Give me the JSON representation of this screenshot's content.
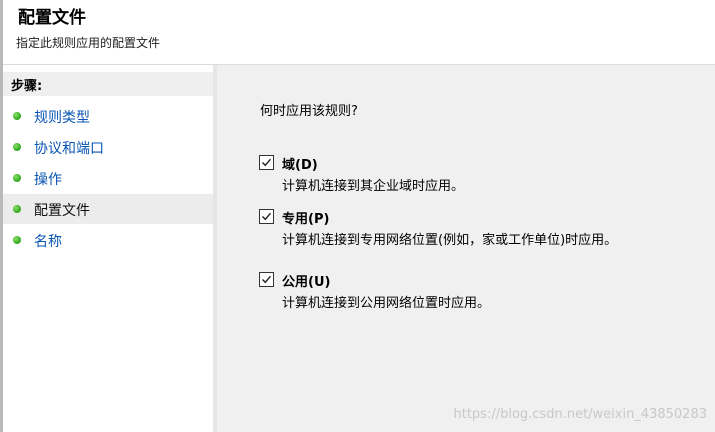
{
  "header": {
    "title": "配置文件",
    "subtitle": "指定此规则应用的配置文件"
  },
  "steps": {
    "heading": "步骤:",
    "items": [
      {
        "label": "规则类型",
        "selected": false
      },
      {
        "label": "协议和端口",
        "selected": false
      },
      {
        "label": "操作",
        "selected": false
      },
      {
        "label": "配置文件",
        "selected": true
      },
      {
        "label": "名称",
        "selected": false
      }
    ]
  },
  "content": {
    "question": "何时应用该规则?",
    "options": [
      {
        "title": "域(D)",
        "description": "计算机连接到其企业域时应用。",
        "checked": true
      },
      {
        "title": "专用(P)",
        "description": "计算机连接到专用网络位置(例如，家或工作单位)时应用。",
        "checked": true
      },
      {
        "title": "公用(U)",
        "description": "计算机连接到公用网络位置时应用。",
        "checked": true
      }
    ]
  },
  "watermark": "https://blog.csdn.net/weixin_43850283",
  "colors": {
    "link": "#0a55b3",
    "step_dot": "#3db12a",
    "content_bg": "#f0f0f0",
    "selected_step_bg": "#ececec"
  }
}
